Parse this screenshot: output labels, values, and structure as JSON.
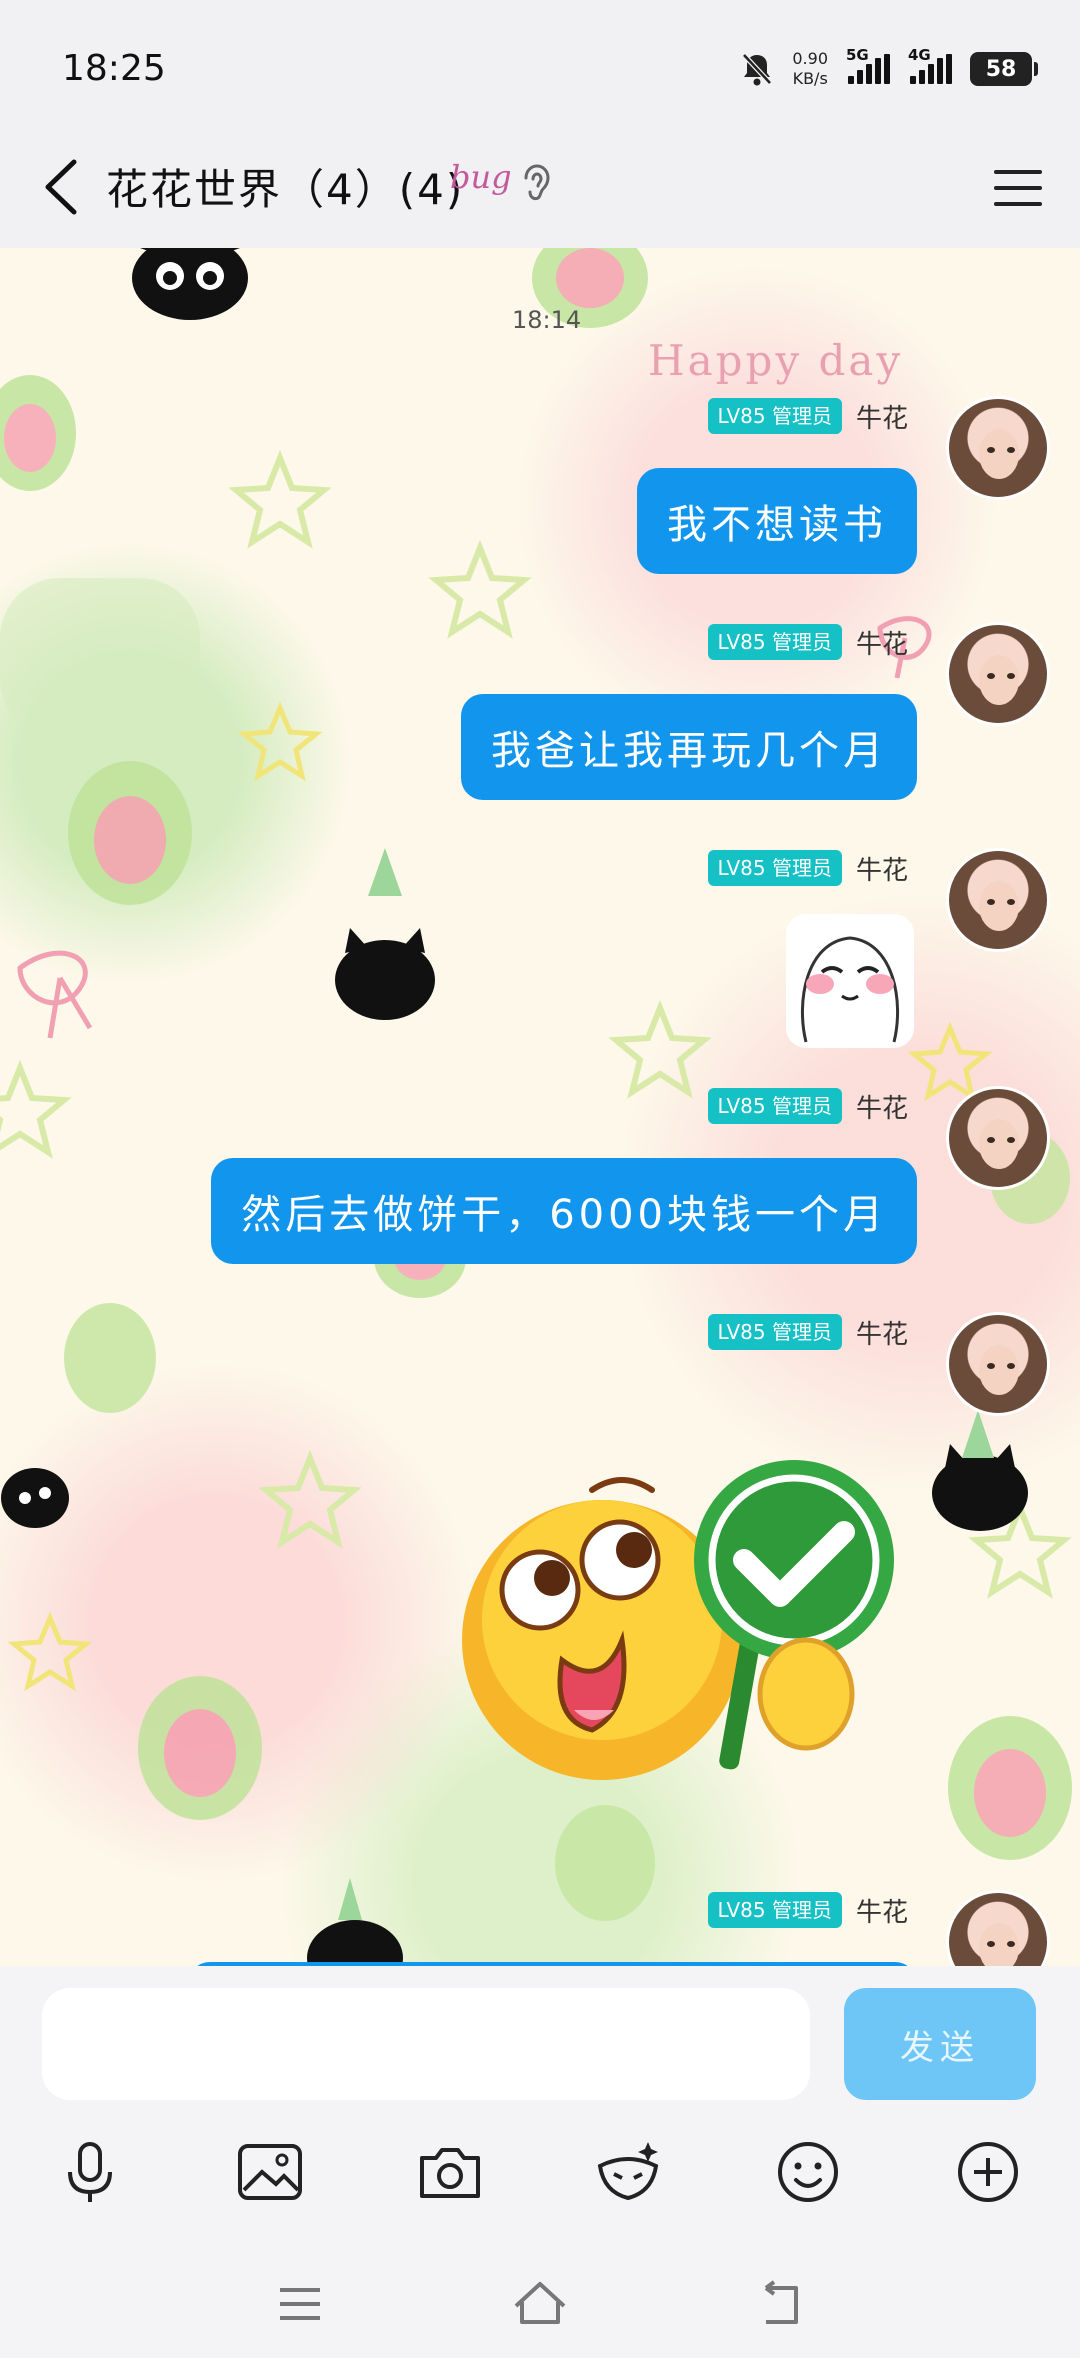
{
  "status_bar": {
    "time": "18:25",
    "net_speed_value": "0.90",
    "net_speed_unit": "KB/s",
    "signal1_label": "5G",
    "signal2_label": "4G",
    "battery": "58"
  },
  "header": {
    "title": "花花世界（4）(4)",
    "badge_text": "bug"
  },
  "chat": {
    "timestamp": "18:14",
    "background_text": "Happy day",
    "messages": [
      {
        "level": "LV85 管理员",
        "sender": "牛花",
        "type": "text",
        "text": "我不想读书"
      },
      {
        "level": "LV85 管理员",
        "sender": "牛花",
        "type": "text",
        "text": "我爸让我再玩几个月"
      },
      {
        "level": "LV85 管理员",
        "sender": "牛花",
        "type": "sticker",
        "sticker": "blushing-face-sticker"
      },
      {
        "level": "LV85 管理员",
        "sender": "牛花",
        "type": "text",
        "text": "然后去做饼干，6000块钱一个月"
      },
      {
        "level": "LV85 管理员",
        "sender": "牛花",
        "type": "sticker",
        "sticker": "emoji-ok-sign-sticker"
      },
      {
        "level": "LV85 管理员",
        "sender": "牛花",
        "type": "text",
        "text": ""
      }
    ]
  },
  "input": {
    "placeholder": "",
    "send_label": "发送"
  },
  "toolbar": {
    "icons": [
      "microphone-icon",
      "image-icon",
      "camera-icon",
      "magic-icon",
      "emoji-icon",
      "plus-icon"
    ]
  },
  "navigation": {
    "icons": [
      "menu-icon",
      "home-icon",
      "back-icon"
    ]
  },
  "colors": {
    "bubble": "#1295ec",
    "level_badge": "#16c1c6",
    "send_button": "#6ec6f6"
  }
}
